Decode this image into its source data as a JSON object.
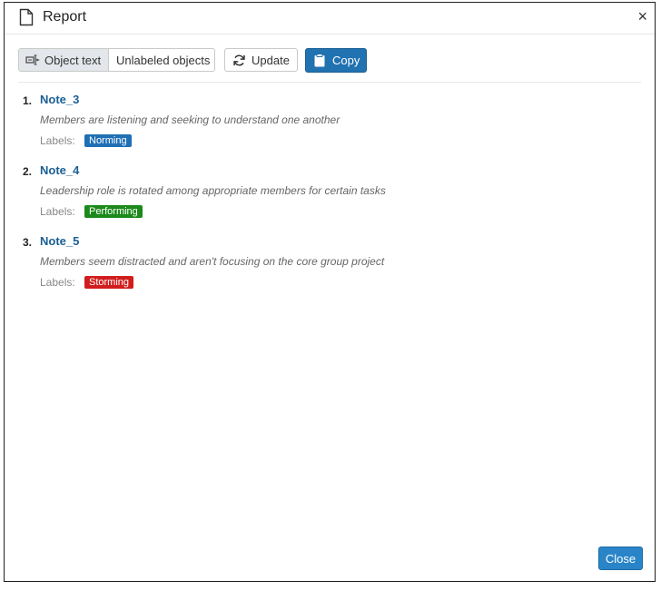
{
  "dialog": {
    "title": "Report",
    "close_glyph": "×",
    "close_button_label": "Close"
  },
  "toolbar": {
    "object_text_label": "Object text",
    "unlabeled_objects_label": "Unlabeled objects",
    "update_label": "Update",
    "copy_label": "Copy"
  },
  "report": {
    "labels_prefix": "Labels:",
    "items": [
      {
        "number": "1.",
        "name": "Note_3",
        "description": "Members are listening and seeking to understand one another",
        "label": "Norming",
        "label_color": "#1f6fb5"
      },
      {
        "number": "2.",
        "name": "Note_4",
        "description": "Leadership role is rotated among appropriate members for certain tasks",
        "label": "Performing",
        "label_color": "#1b8a1b"
      },
      {
        "number": "3.",
        "name": "Note_5",
        "description": "Members seem distracted and aren't focusing on the core group project",
        "label": "Storming",
        "label_color": "#d11d1d"
      }
    ]
  },
  "icons": [
    "document-icon",
    "object-text-icon",
    "refresh-icon",
    "clipboard-icon"
  ]
}
